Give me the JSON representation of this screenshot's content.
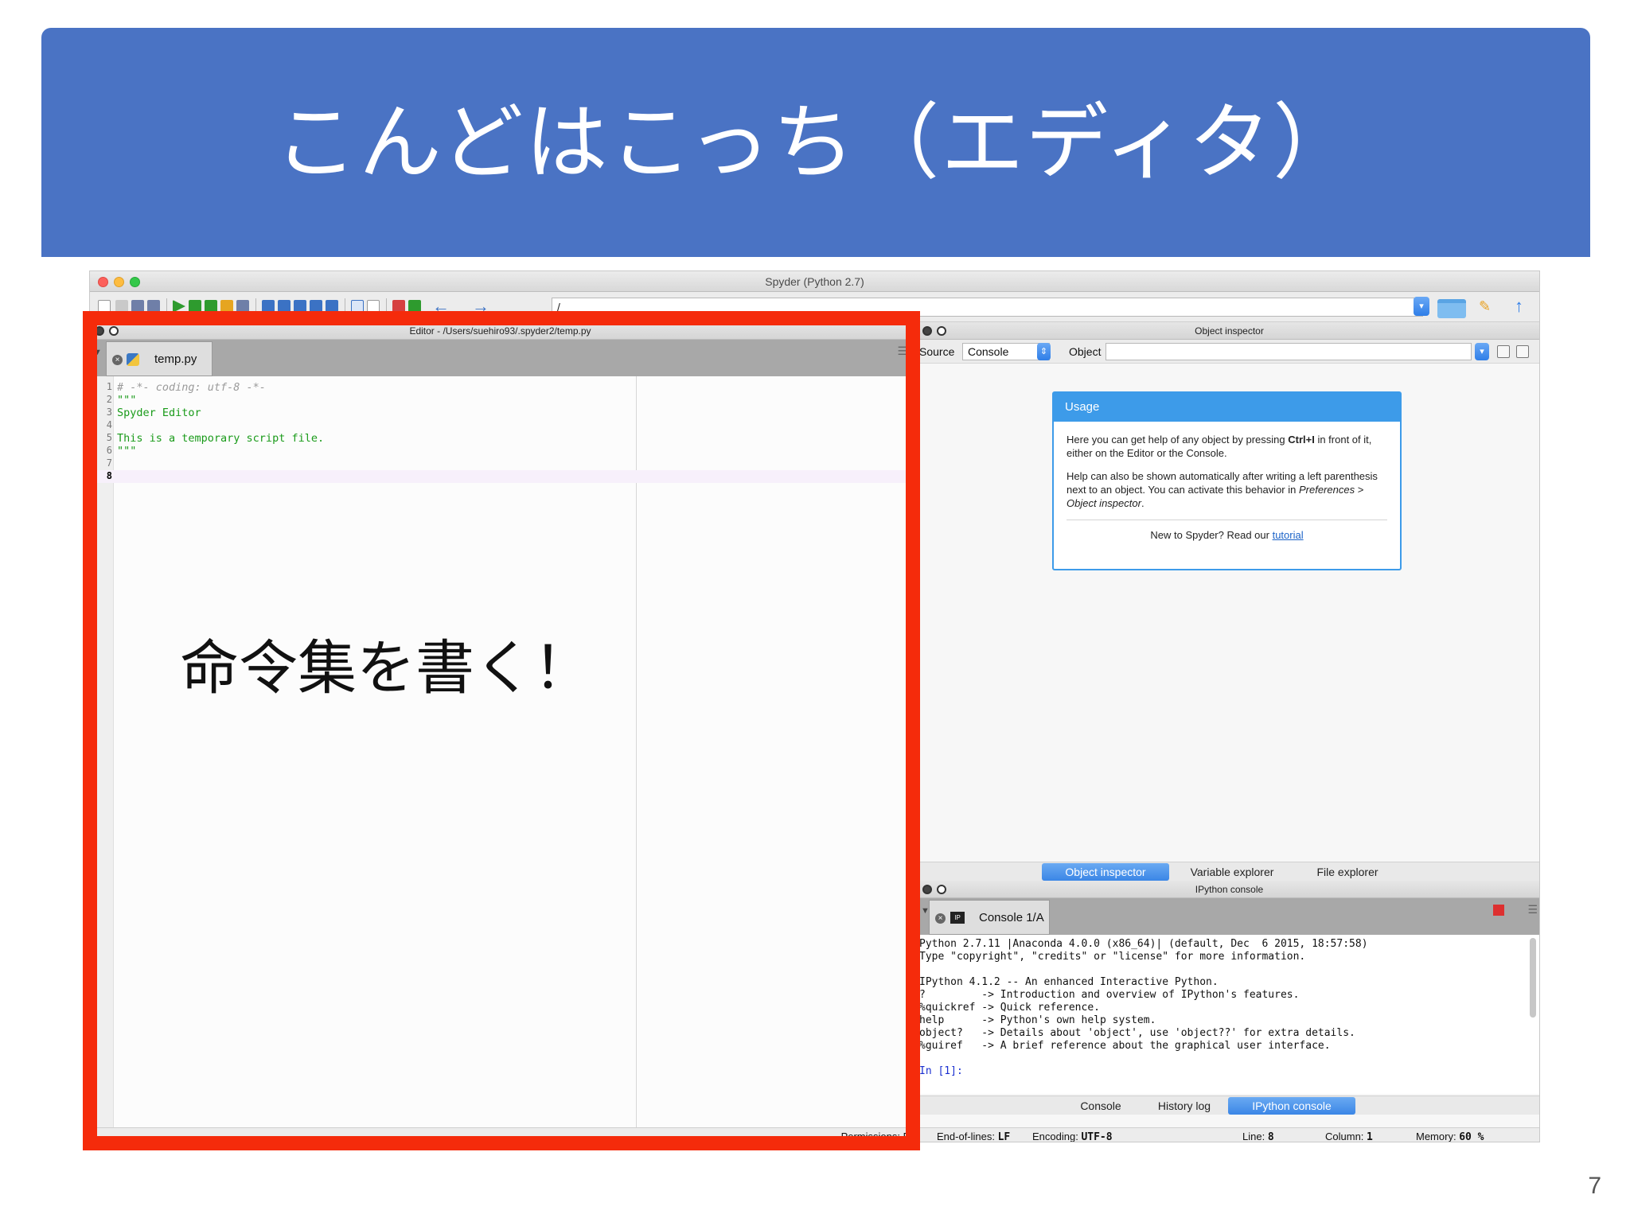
{
  "slide": {
    "title": "こんどはこっち（エディタ）",
    "annotation": "命令集を書く！",
    "page_number": "7",
    "colors": {
      "banner": "#4a73c4",
      "highlight_border": "#f52b0b"
    }
  },
  "window": {
    "title": "Spyder (Python 2.7)",
    "path": "/"
  },
  "editor": {
    "header_title": "Editor - /Users/suehiro93/.spyder2/temp.py",
    "tab_label": "temp.py",
    "lines": [
      {
        "num": "1",
        "text": "# -*- coding: utf-8 -*-",
        "kind": "comment"
      },
      {
        "num": "2",
        "text": "\"\"\"",
        "kind": "string"
      },
      {
        "num": "3",
        "text": "Spyder Editor",
        "kind": "string"
      },
      {
        "num": "4",
        "text": "",
        "kind": "string"
      },
      {
        "num": "5",
        "text": "This is a temporary script file.",
        "kind": "string"
      },
      {
        "num": "6",
        "text": "\"\"\"",
        "kind": "string"
      },
      {
        "num": "7",
        "text": "",
        "kind": "plain"
      },
      {
        "num": "8",
        "text": "",
        "kind": "current"
      }
    ],
    "status_permissions": "Permissions: R"
  },
  "inspector": {
    "header_title": "Object inspector",
    "source_label": "Source",
    "source_value": "Console",
    "object_label": "Object",
    "usage": {
      "title": "Usage",
      "p1_prefix": "Here you can get help of any object by pressing ",
      "p1_key": "Ctrl+I",
      "p1_suffix": " in front of it, either on the Editor or the Console.",
      "p2_prefix": "Help can also be shown automatically after writing a left parenthesis next to an object. You can activate this behavior in ",
      "p2_path": "Preferences > Object inspector",
      "p2_suffix": ".",
      "footer_text": "New to Spyder? Read our ",
      "footer_link": "tutorial"
    }
  },
  "mid_tabs": [
    "Object inspector",
    "Variable explorer",
    "File explorer"
  ],
  "console": {
    "header_title": "IPython console",
    "tab_label": "Console 1/A",
    "output": [
      "Python 2.7.11 |Anaconda 4.0.0 (x86_64)| (default, Dec  6 2015, 18:57:58)",
      "Type \"copyright\", \"credits\" or \"license\" for more information.",
      "",
      "IPython 4.1.2 -- An enhanced Interactive Python.",
      "?         -> Introduction and overview of IPython's features.",
      "%quickref -> Quick reference.",
      "help      -> Python's own help system.",
      "object?   -> Details about 'object', use 'object??' for extra details.",
      "%guiref   -> A brief reference about the graphical user interface.",
      ""
    ],
    "prompt": "In [1]:",
    "bottom_tabs": [
      "Console",
      "History log",
      "IPython console"
    ]
  },
  "status": {
    "eol_label": "End-of-lines:",
    "eol_value": "LF",
    "encoding_label": "Encoding:",
    "encoding_value": "UTF-8",
    "line_label": "Line:",
    "line_value": "8",
    "column_label": "Column:",
    "column_value": "1",
    "memory_label": "Memory:",
    "memory_value": "60 %"
  }
}
